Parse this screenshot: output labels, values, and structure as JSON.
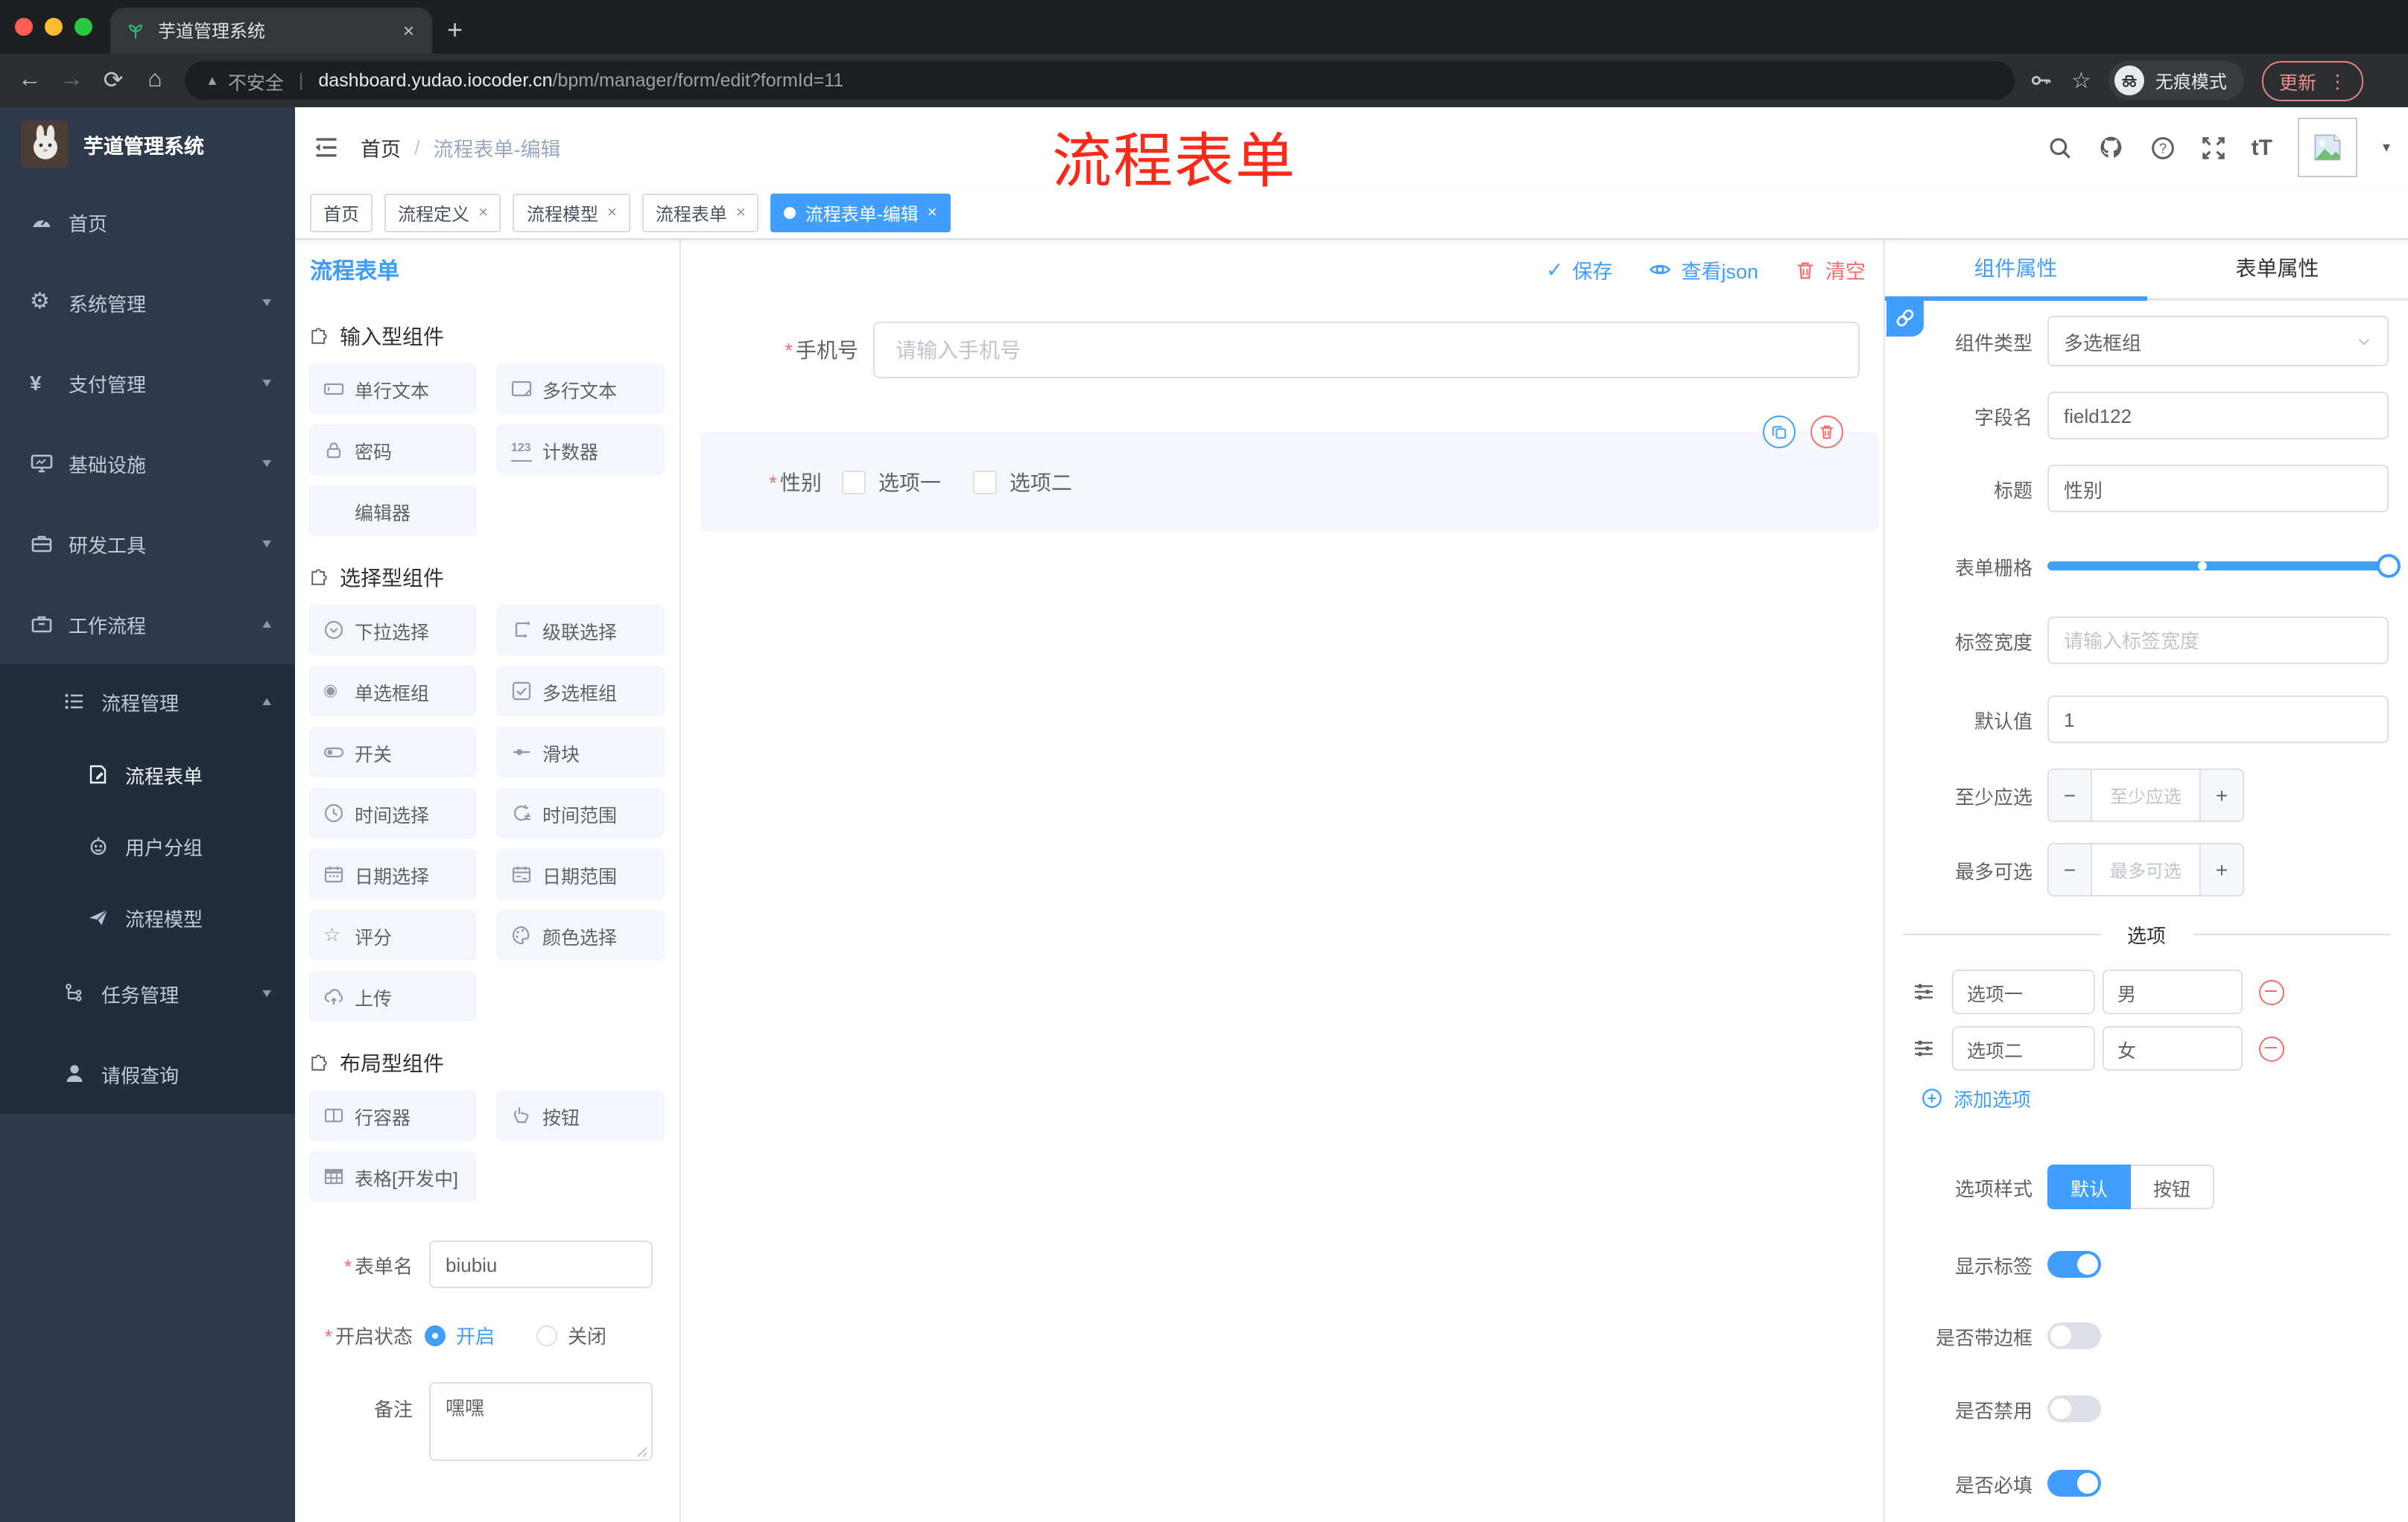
{
  "browser": {
    "tab_title": "芋道管理系统",
    "security_label": "不安全",
    "url_domain": "dashboard.yudao.iocoder.cn",
    "url_path": "/bpm/manager/form/edit?formId=11",
    "incognito_label": "无痕模式",
    "update_label": "更新"
  },
  "icons": {
    "close": "×",
    "new_tab": "+",
    "menu_dots": "⋮",
    "back": "←",
    "forward": "→",
    "reload": "⟳",
    "home": "⌂",
    "warning": "▲",
    "pipe": "|",
    "bookmark_star": "☆",
    "caret_down": "▾",
    "slash": "/",
    "check": "✓",
    "question": "?",
    "yen": "¥",
    "gear": "⚙",
    "font_size": "tT",
    "radio_dot": "◉",
    "rate_star": "☆",
    "asterisk": "*",
    "minus": "−",
    "plus": "+",
    "counter": "123",
    "add_circle": "⊕"
  },
  "annotation": "流程表单",
  "sidebar": {
    "title": "芋道管理系统",
    "items": [
      {
        "label": "首页"
      },
      {
        "label": "系统管理"
      },
      {
        "label": "支付管理"
      },
      {
        "label": "基础设施"
      },
      {
        "label": "研发工具"
      },
      {
        "label": "工作流程"
      }
    ],
    "sub_items": [
      {
        "label": "流程管理"
      },
      {
        "label": "流程表单"
      },
      {
        "label": "用户分组"
      },
      {
        "label": "流程模型"
      },
      {
        "label": "任务管理"
      },
      {
        "label": "请假查询"
      }
    ]
  },
  "navbar": {
    "breadcrumb_home": "首页",
    "breadcrumb_current": "流程表单-编辑"
  },
  "tags": {
    "items": [
      {
        "label": "首页"
      },
      {
        "label": "流程定义"
      },
      {
        "label": "流程模型"
      },
      {
        "label": "流程表单"
      },
      {
        "label": "流程表单-编辑"
      }
    ]
  },
  "designer": {
    "title": "流程表单",
    "save": "保存",
    "view_json": "查看json",
    "clear": "清空"
  },
  "components": {
    "sections": [
      {
        "title": "输入型组件",
        "items": [
          {
            "label": "单行文本"
          },
          {
            "label": "多行文本"
          },
          {
            "label": "密码"
          },
          {
            "label": "计数器"
          },
          {
            "label": "编辑器"
          }
        ]
      },
      {
        "title": "选择型组件",
        "items": [
          {
            "label": "下拉选择"
          },
          {
            "label": "级联选择"
          },
          {
            "label": "单选框组"
          },
          {
            "label": "多选框组"
          },
          {
            "label": "开关"
          },
          {
            "label": "滑块"
          },
          {
            "label": "时间选择"
          },
          {
            "label": "时间范围"
          },
          {
            "label": "日期选择"
          },
          {
            "label": "日期范围"
          },
          {
            "label": "评分"
          },
          {
            "label": "颜色选择"
          },
          {
            "label": "上传"
          }
        ]
      },
      {
        "title": "布局型组件",
        "items": [
          {
            "label": "行容器"
          },
          {
            "label": "按钮"
          },
          {
            "label": "表格[开发中]"
          }
        ]
      }
    ]
  },
  "settings_form": {
    "name_label": "表单名",
    "name_value": "biubiu",
    "status_label": "开启状态",
    "status_on": "开启",
    "status_off": "关闭",
    "remark_label": "备注",
    "remark_value": "嘿嘿"
  },
  "canvas": {
    "phone_label": "手机号",
    "phone_placeholder": "请输入手机号",
    "gender_label": "性别",
    "gender_option1": "选项一",
    "gender_option2": "选项二"
  },
  "props": {
    "tab_component": "组件属性",
    "tab_form": "表单属性",
    "type_label": "组件类型",
    "type_value": "多选框组",
    "field_label": "字段名",
    "field_value": "field122",
    "title_label": "标题",
    "title_value": "性别",
    "grid_label": "表单栅格",
    "width_label": "标签宽度",
    "width_placeholder": "请输入标签宽度",
    "default_label": "默认值",
    "default_value": "1",
    "min_label": "至少应选",
    "min_placeholder": "至少应选",
    "max_label": "最多可选",
    "max_placeholder": "最多可选",
    "options_title": "选项",
    "option1_label": "选项一",
    "option1_value": "男",
    "option2_label": "选项二",
    "option2_value": "女",
    "add_option": "添加选项",
    "style_label": "选项样式",
    "style_default": "默认",
    "style_button": "按钮",
    "toggle_show_label": "显示标签",
    "toggle_border": "是否带边框",
    "toggle_disabled": "是否禁用",
    "toggle_required": "是否必填"
  },
  "colors": {
    "accent": "#409eff",
    "danger": "#f56c6c",
    "annotation": "#fd2a1a",
    "sidebar_bg": "#2d3a4b",
    "sidebar_sub_bg": "#1f2d3d",
    "active_tag": "#409eff"
  }
}
